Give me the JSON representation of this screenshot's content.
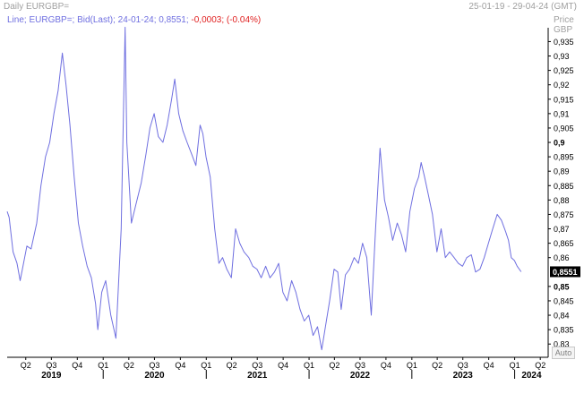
{
  "window": {
    "title": "Daily EURGBP=",
    "date_range": "25-01-19 - 29-04-24 (GMT)"
  },
  "legend": {
    "prefix": "Line; EURGBP=; Bid(Last); 24-01-24; 0,8551;",
    "change": " -0,0003; (-0.04%)"
  },
  "price_axis_title": [
    "Price",
    "GBP"
  ],
  "auto_button": "Auto",
  "colors": {
    "line": "#6f6fe0",
    "negative": "#e02020",
    "last_price_box": "#000000"
  },
  "chart_data": {
    "type": "line",
    "title": "",
    "series": [
      {
        "name": "",
        "x": [
          "2019-01-25",
          "2019-02-01",
          "2019-02-15",
          "2019-03-01",
          "2019-03-12",
          "2019-03-20",
          "2019-04-05",
          "2019-04-20",
          "2019-05-10",
          "2019-05-25",
          "2019-06-10",
          "2019-06-25",
          "2019-07-10",
          "2019-07-25",
          "2019-08-09",
          "2019-08-22",
          "2019-09-05",
          "2019-09-20",
          "2019-10-05",
          "2019-10-20",
          "2019-11-05",
          "2019-11-20",
          "2019-12-05",
          "2019-12-13",
          "2019-12-27",
          "2020-01-10",
          "2020-01-28",
          "2020-02-15",
          "2020-03-05",
          "2020-03-19",
          "2020-03-25",
          "2020-04-10",
          "2020-04-25",
          "2020-05-15",
          "2020-06-01",
          "2020-06-15",
          "2020-06-30",
          "2020-07-15",
          "2020-07-31",
          "2020-08-15",
          "2020-08-31",
          "2020-09-11",
          "2020-09-25",
          "2020-10-10",
          "2020-10-25",
          "2020-11-10",
          "2020-11-25",
          "2020-12-10",
          "2020-12-20",
          "2020-12-31",
          "2021-01-15",
          "2021-01-31",
          "2021-02-15",
          "2021-02-28",
          "2021-03-15",
          "2021-03-31",
          "2021-04-15",
          "2021-04-30",
          "2021-05-15",
          "2021-06-01",
          "2021-06-15",
          "2021-06-30",
          "2021-07-15",
          "2021-07-31",
          "2021-08-15",
          "2021-08-31",
          "2021-09-15",
          "2021-09-30",
          "2021-10-15",
          "2021-10-31",
          "2021-11-15",
          "2021-11-30",
          "2021-12-15",
          "2021-12-31",
          "2022-01-15",
          "2022-01-31",
          "2022-02-15",
          "2022-02-28",
          "2022-03-15",
          "2022-03-31",
          "2022-04-13",
          "2022-04-25",
          "2022-05-10",
          "2022-05-25",
          "2022-06-10",
          "2022-06-25",
          "2022-07-10",
          "2022-07-25",
          "2022-08-10",
          "2022-08-25",
          "2022-09-10",
          "2022-09-26",
          "2022-10-10",
          "2022-10-25",
          "2022-11-10",
          "2022-11-25",
          "2022-12-10",
          "2022-12-25",
          "2023-01-10",
          "2023-01-25",
          "2023-02-03",
          "2023-02-15",
          "2023-02-28",
          "2023-03-15",
          "2023-03-31",
          "2023-04-15",
          "2023-04-30",
          "2023-05-15",
          "2023-05-31",
          "2023-06-15",
          "2023-06-30",
          "2023-07-15",
          "2023-07-31",
          "2023-08-15",
          "2023-08-31",
          "2023-09-15",
          "2023-09-30",
          "2023-10-15",
          "2023-10-31",
          "2023-11-15",
          "2023-11-30",
          "2023-12-10",
          "2023-12-20",
          "2023-12-31",
          "2024-01-10",
          "2024-01-24"
        ],
        "y": [
          0.876,
          0.874,
          0.862,
          0.858,
          0.852,
          0.856,
          0.864,
          0.863,
          0.872,
          0.885,
          0.895,
          0.9,
          0.91,
          0.918,
          0.931,
          0.92,
          0.906,
          0.888,
          0.872,
          0.864,
          0.857,
          0.853,
          0.844,
          0.835,
          0.848,
          0.852,
          0.84,
          0.832,
          0.87,
          0.94,
          0.9,
          0.872,
          0.878,
          0.886,
          0.896,
          0.905,
          0.91,
          0.902,
          0.9,
          0.906,
          0.915,
          0.922,
          0.91,
          0.904,
          0.9,
          0.896,
          0.892,
          0.906,
          0.903,
          0.895,
          0.888,
          0.87,
          0.858,
          0.86,
          0.856,
          0.853,
          0.87,
          0.865,
          0.862,
          0.86,
          0.857,
          0.856,
          0.853,
          0.857,
          0.853,
          0.855,
          0.858,
          0.848,
          0.845,
          0.852,
          0.848,
          0.842,
          0.838,
          0.84,
          0.833,
          0.836,
          0.828,
          0.836,
          0.845,
          0.856,
          0.855,
          0.842,
          0.854,
          0.856,
          0.86,
          0.858,
          0.865,
          0.86,
          0.84,
          0.87,
          0.898,
          0.88,
          0.874,
          0.866,
          0.872,
          0.868,
          0.862,
          0.876,
          0.884,
          0.888,
          0.893,
          0.888,
          0.882,
          0.875,
          0.862,
          0.87,
          0.86,
          0.862,
          0.86,
          0.858,
          0.857,
          0.86,
          0.861,
          0.855,
          0.856,
          0.86,
          0.865,
          0.87,
          0.875,
          0.873,
          0.869,
          0.866,
          0.86,
          0.859,
          0.857,
          0.8551
        ]
      }
    ],
    "y_ticks": [
      "0,935",
      "0,93",
      "0,925",
      "0,92",
      "0,915",
      "0,91",
      "0,905",
      "0,9",
      "0,895",
      "0,89",
      "0,885",
      "0,88",
      "0,875",
      "0,87",
      "0,865",
      "0,86",
      "0,85",
      "0,845",
      "0,84",
      "0,835",
      "0,83"
    ],
    "y_ticks_bold": [
      "0,9",
      "0,85"
    ],
    "ylim": [
      0.8254,
      0.9398
    ],
    "last_price_label": "0,8551",
    "quarter_ticks": [
      {
        "label": "Q2",
        "date": "2019-04-01"
      },
      {
        "label": "Q3",
        "date": "2019-07-01"
      },
      {
        "label": "Q4",
        "date": "2019-10-01"
      },
      {
        "label": "Q1",
        "date": "2020-01-01"
      },
      {
        "label": "Q2",
        "date": "2020-04-01"
      },
      {
        "label": "Q3",
        "date": "2020-07-01"
      },
      {
        "label": "Q4",
        "date": "2020-10-01"
      },
      {
        "label": "Q1",
        "date": "2021-01-01"
      },
      {
        "label": "Q2",
        "date": "2021-04-01"
      },
      {
        "label": "Q3",
        "date": "2021-07-01"
      },
      {
        "label": "Q4",
        "date": "2021-10-01"
      },
      {
        "label": "Q1",
        "date": "2022-01-01"
      },
      {
        "label": "Q2",
        "date": "2022-04-01"
      },
      {
        "label": "Q3",
        "date": "2022-07-01"
      },
      {
        "label": "Q4",
        "date": "2022-10-01"
      },
      {
        "label": "Q1",
        "date": "2023-01-01"
      },
      {
        "label": "Q2",
        "date": "2023-04-01"
      },
      {
        "label": "Q3",
        "date": "2023-07-01"
      },
      {
        "label": "Q4",
        "date": "2023-10-01"
      },
      {
        "label": "Q1",
        "date": "2024-01-01"
      },
      {
        "label": "Q2",
        "date": "2024-04-01"
      }
    ],
    "year_labels": [
      {
        "label": "2019",
        "date": "2019-07-01"
      },
      {
        "label": "2020",
        "date": "2020-07-01"
      },
      {
        "label": "2021",
        "date": "2021-07-01"
      },
      {
        "label": "2022",
        "date": "2022-07-01"
      },
      {
        "label": "2023",
        "date": "2023-07-01"
      },
      {
        "label": "2024",
        "date": "2024-03-01"
      }
    ],
    "year_boundaries": [
      "2020-01-01",
      "2021-01-01",
      "2022-01-01",
      "2023-01-01",
      "2024-01-01"
    ],
    "xlim": [
      "2019-01-25",
      "2024-04-29"
    ],
    "grid": false,
    "legend": "top-left"
  }
}
